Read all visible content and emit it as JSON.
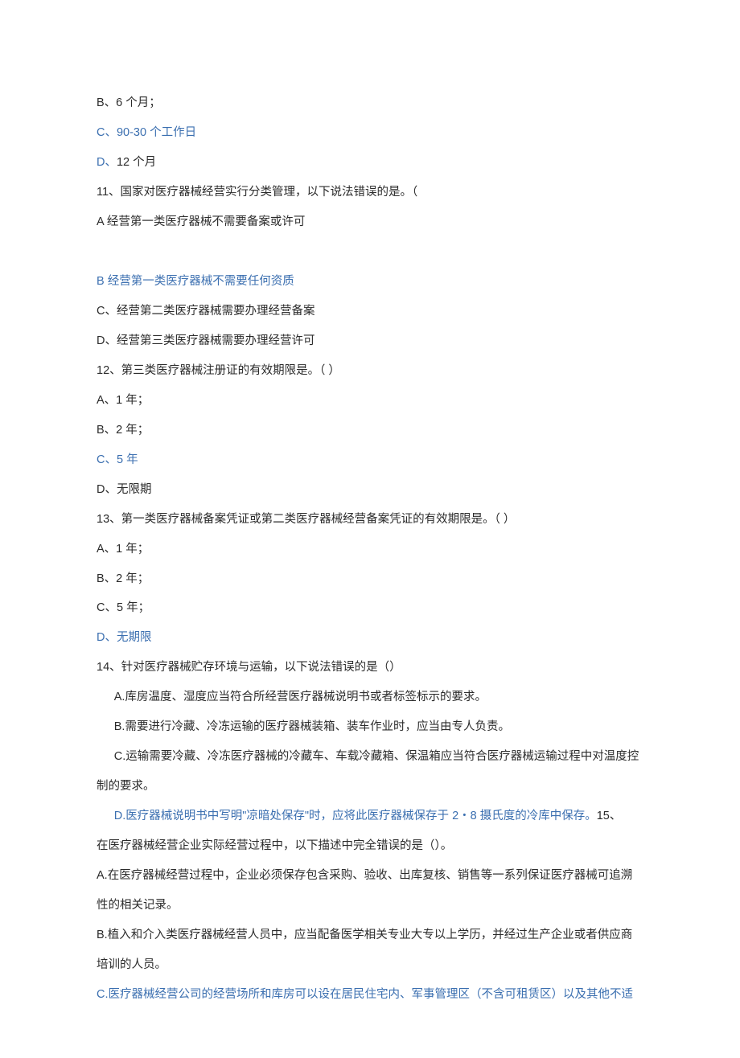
{
  "lines": [
    {
      "text": "B、6 个月；",
      "blue": false,
      "indent": false
    },
    {
      "text": "C、90-30 个工作日",
      "blue": true,
      "indent": false
    },
    {
      "text": "D、12 个月",
      "blue": true,
      "indent": false,
      "segments": [
        {
          "t": "D、",
          "blue": true
        },
        {
          "t": "12 个月",
          "blue": false
        }
      ]
    },
    {
      "text": "11、国家对医疗器械经营实行分类管理，以下说法错误的是。（",
      "blue": false,
      "indent": false
    },
    {
      "text": "A 经营第一类医疗器械不需要备案或许可",
      "blue": false,
      "indent": false
    },
    {
      "text": "",
      "blue": false,
      "indent": false
    },
    {
      "text": "B 经营第一类医疗器械不需要任何资质",
      "blue": true,
      "indent": false
    },
    {
      "text": "C、经营第二类医疗器械需要办理经营备案",
      "blue": false,
      "indent": false
    },
    {
      "text": "D、经营第三类医疗器械需要办理经营许可",
      "blue": false,
      "indent": false
    },
    {
      "text": "12、第三类医疗器械注册证的有效期限是。（              ）",
      "blue": false,
      "indent": false
    },
    {
      "text": "A、1 年；",
      "blue": false,
      "indent": false
    },
    {
      "text": "B、2 年；",
      "blue": false,
      "indent": false
    },
    {
      "text": "C、5 年",
      "blue": true,
      "indent": false
    },
    {
      "text": "D、无限期",
      "blue": false,
      "indent": false
    },
    {
      "text": "13、第一类医疗器械备案凭证或第二类医疗器械经营备案凭证的有效期限是。（                 ）",
      "blue": false,
      "indent": false
    },
    {
      "text": "A、1 年；",
      "blue": false,
      "indent": false
    },
    {
      "text": "B、2 年；",
      "blue": false,
      "indent": false
    },
    {
      "text": "C、5 年；",
      "blue": false,
      "indent": false
    },
    {
      "text": "D、无期限",
      "blue": true,
      "indent": false
    },
    {
      "text": "14、针对医疗器械贮存环境与运输，以下说法错误的是（）",
      "blue": false,
      "indent": false
    },
    {
      "text": "A.库房温度、湿度应当符合所经营医疗器械说明书或者标签标示的要求。",
      "blue": false,
      "indent": true
    },
    {
      "text": "B.需要进行冷藏、冷冻运输的医疗器械装箱、装车作业时，应当由专人负责。",
      "blue": false,
      "indent": true
    },
    {
      "text": "C.运输需要冷藏、冷冻医疗器械的冷藏车、车载冷藏箱、保温箱应当符合医疗器械运输过程中对温度控",
      "blue": false,
      "indent": true
    },
    {
      "text": "制的要求。",
      "blue": false,
      "indent": false
    },
    {
      "text": "",
      "blue": false,
      "indent": false,
      "mixed": [
        {
          "t": "D.医疗器械说明书中写明\"凉暗处保存\"时，应将此医疗器械保存于 2・8 摄氏度的冷库中保存。",
          "blue": true,
          "indent": true
        },
        {
          "t": "15、",
          "blue": false,
          "indent": false
        }
      ]
    },
    {
      "text": "在医疗器械经营企业实际经营过程中，以下描述中完全错误的是（）。",
      "blue": false,
      "indent": false
    },
    {
      "text": "A.在医疗器械经营过程中，企业必须保存包含采购、验收、出库复核、销售等一系列保证医疗器械可追溯",
      "blue": false,
      "indent": false
    },
    {
      "text": "性的相关记录。",
      "blue": false,
      "indent": false
    },
    {
      "text": "B.植入和介入类医疗器械经营人员中，应当配备医学相关专业大专以上学历，并经过生产企业或者供应商",
      "blue": false,
      "indent": false
    },
    {
      "text": "培训的人员。",
      "blue": false,
      "indent": false
    },
    {
      "text": "C.医疗器械经营公司的经营场所和库房可以设在居民住宅内、军事管理区（不含可租赁区）以及其他不适",
      "blue": true,
      "indent": false
    }
  ]
}
